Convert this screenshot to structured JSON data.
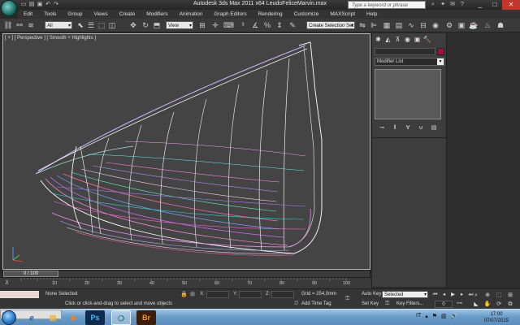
{
  "window": {
    "title": "Autodesk 3ds Max 2011 x64     LeudoFeliceMarvin.max",
    "search_placeholder": "Type a keyword or phrase",
    "controls": [
      "_",
      "□",
      "✕"
    ]
  },
  "menu": [
    "Edit",
    "Tools",
    "Group",
    "Views",
    "Create",
    "Modifiers",
    "Animation",
    "Graph Editors",
    "Rendering",
    "Customize",
    "MAXScript",
    "Help"
  ],
  "toolbar": {
    "filter_dropdown": "All",
    "ref_coord_dropdown": "View",
    "selection_set_dropdown": "Create Selection Set"
  },
  "viewport": {
    "label": "[ + ] [ Perspective ] [ Smooth + Highlights ]"
  },
  "command_panel": {
    "modifier_list_label": "Modifier List",
    "tab_icons": [
      "create-icon",
      "modify-icon",
      "hierarchy-icon",
      "motion-icon",
      "display-icon",
      "utilities-icon"
    ],
    "object_color": "#b0093b"
  },
  "timeline": {
    "frame_display": "0 / 100",
    "ticks": [
      "0",
      "10",
      "20",
      "30",
      "40",
      "50",
      "60",
      "70",
      "80",
      "90",
      "100"
    ]
  },
  "status": {
    "selection": "None Selected",
    "prompt": "Click or click-and-drag to select and move objects",
    "x_label": "X:",
    "y_label": "Y:",
    "z_label": "Z:",
    "grid": "Grid = 254,0mm",
    "add_time_tag": "Add Time Tag",
    "auto_key": "Auto Key",
    "set_key": "Set Key",
    "selected_dropdown": "Selected",
    "key_filters": "Key Filters...",
    "current_frame": "0",
    "maxscript_label": "M"
  },
  "taskbar": {
    "active_window": "Ma",
    "apps": [
      "ie-icon",
      "explorer-icon",
      "media-player-icon",
      "photoshop-icon",
      "3dsmax-icon",
      "bridge-icon"
    ],
    "photoshop_label": "Ps",
    "bridge_label": "Br",
    "language": "IT",
    "time": "17:00",
    "date": "07/07/2015"
  }
}
